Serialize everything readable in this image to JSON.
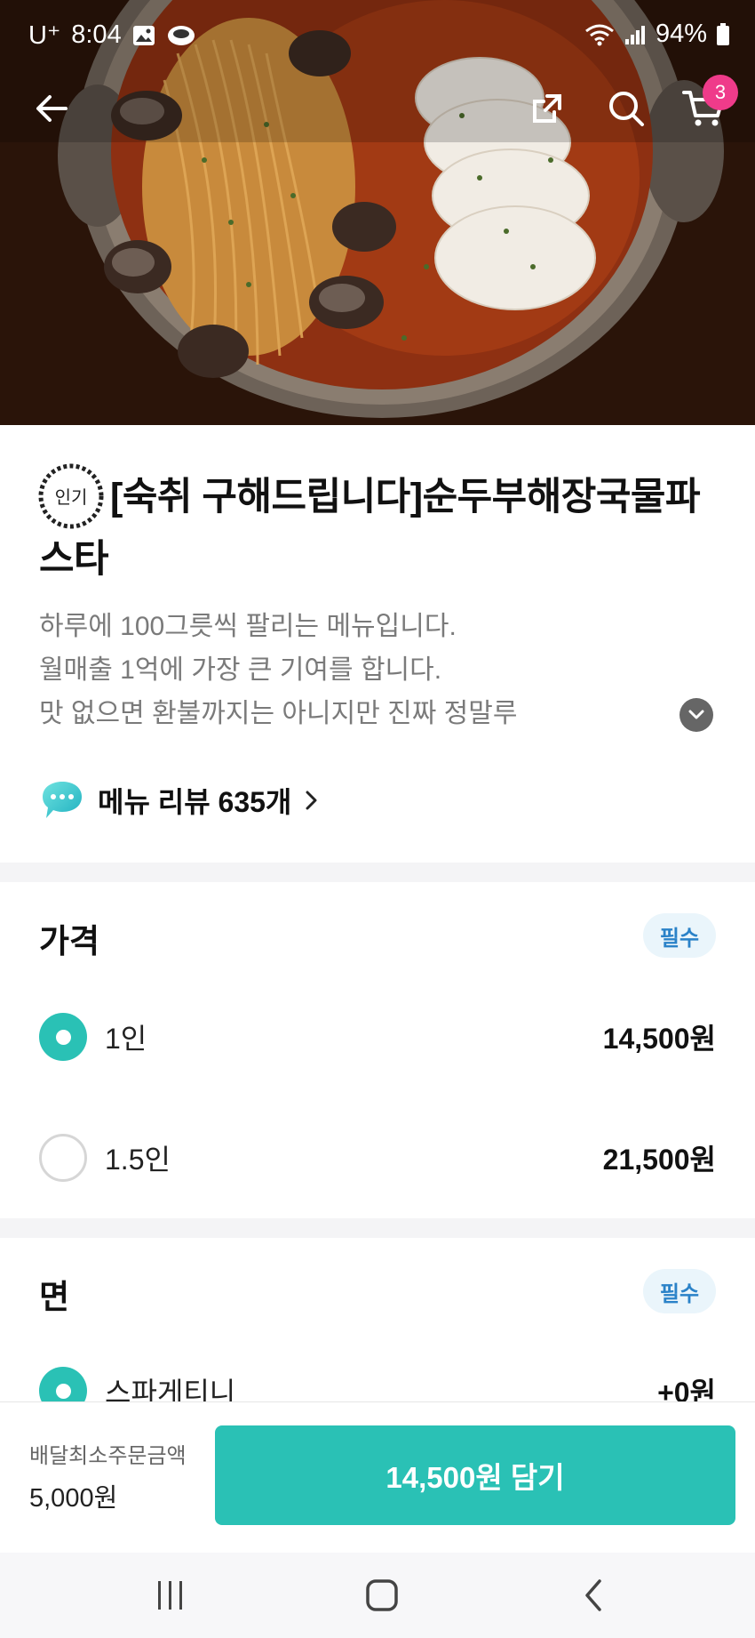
{
  "status_bar": {
    "carrier": "U⁺",
    "time": "8:04",
    "battery": "94%"
  },
  "nav": {
    "cart_count": "3"
  },
  "menu": {
    "badge": "인기",
    "title": "[숙취 구해드립니다]순두부해장국물파스타",
    "description": [
      "하루에 100그릇씩 팔리는 메뉴입니다.",
      "월매출 1억에 가장 큰 기여를 합니다.",
      "맛 없으면 환불까지는 아니지만 진짜 정말루"
    ],
    "review_link": "메뉴 리뷰 635개"
  },
  "price_section": {
    "title": "가격",
    "badge": "필수",
    "options": [
      {
        "label": "1인",
        "price": "14,500원",
        "selected": true
      },
      {
        "label": "1.5인",
        "price": "21,500원",
        "selected": false
      }
    ]
  },
  "noodle_section": {
    "title": "면",
    "badge": "필수",
    "options": [
      {
        "label": "스파게티니",
        "price": "+0원",
        "selected": true
      }
    ]
  },
  "bottom_bar": {
    "min_order_label": "배달최소주문금액",
    "min_order_value": "5,000원",
    "add_button": "14,500원 담기"
  },
  "colors": {
    "accent": "#2ac1b5",
    "badge_pink": "#ef3b8a",
    "required_text": "#2a82c8",
    "required_bg": "#eaf5fb"
  }
}
